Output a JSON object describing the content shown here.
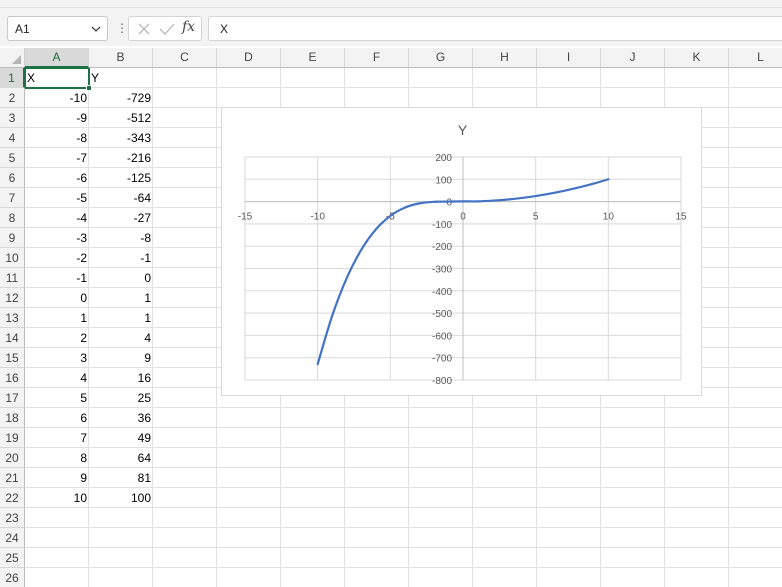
{
  "formula_bar": {
    "name_box": "A1",
    "formula": "X",
    "fx_label": "fx"
  },
  "columns": [
    "A",
    "B",
    "C",
    "D",
    "E",
    "F",
    "G",
    "H",
    "I",
    "J",
    "K",
    "L"
  ],
  "rows": [
    "1",
    "2",
    "3",
    "4",
    "5",
    "6",
    "7",
    "8",
    "9",
    "10",
    "11",
    "12",
    "13",
    "14",
    "15",
    "16",
    "17",
    "18",
    "19",
    "20",
    "21",
    "22",
    "23",
    "24",
    "25",
    "26"
  ],
  "selected_cell": "A1",
  "sheet": {
    "header_x": "X",
    "header_y": "Y",
    "data": [
      {
        "x": "-10",
        "y": "-729"
      },
      {
        "x": "-9",
        "y": "-512"
      },
      {
        "x": "-8",
        "y": "-343"
      },
      {
        "x": "-7",
        "y": "-216"
      },
      {
        "x": "-6",
        "y": "-125"
      },
      {
        "x": "-5",
        "y": "-64"
      },
      {
        "x": "-4",
        "y": "-27"
      },
      {
        "x": "-3",
        "y": "-8"
      },
      {
        "x": "-2",
        "y": "-1"
      },
      {
        "x": "-1",
        "y": "0"
      },
      {
        "x": "0",
        "y": "1"
      },
      {
        "x": "1",
        "y": "1"
      },
      {
        "x": "2",
        "y": "4"
      },
      {
        "x": "3",
        "y": "9"
      },
      {
        "x": "4",
        "y": "16"
      },
      {
        "x": "5",
        "y": "25"
      },
      {
        "x": "6",
        "y": "36"
      },
      {
        "x": "7",
        "y": "49"
      },
      {
        "x": "8",
        "y": "64"
      },
      {
        "x": "9",
        "y": "81"
      },
      {
        "x": "10",
        "y": "100"
      }
    ]
  },
  "chart_data": {
    "type": "scatter",
    "title": "Y",
    "smooth": true,
    "series": [
      {
        "x": [
          -10,
          -9,
          -8,
          -7,
          -6,
          -5,
          -4,
          -3,
          -2,
          -1,
          0,
          1,
          2,
          3,
          4,
          5,
          6,
          7,
          8,
          9,
          10
        ],
        "y": [
          -729,
          -512,
          -343,
          -216,
          -125,
          -64,
          -27,
          -8,
          -1,
          0,
          1,
          1,
          4,
          9,
          16,
          25,
          36,
          49,
          64,
          81,
          100
        ],
        "color": "#4472c4"
      }
    ],
    "xlim": [
      -15,
      15
    ],
    "ylim": [
      -800,
      200
    ],
    "xticks": [
      "-15",
      "-10",
      "-5",
      "0",
      "5",
      "10",
      "15"
    ],
    "yticks": [
      "200",
      "100",
      "0",
      "-100",
      "-200",
      "-300",
      "-400",
      "-500",
      "-600",
      "-700",
      "-800"
    ],
    "grid": true,
    "legend": "none"
  }
}
